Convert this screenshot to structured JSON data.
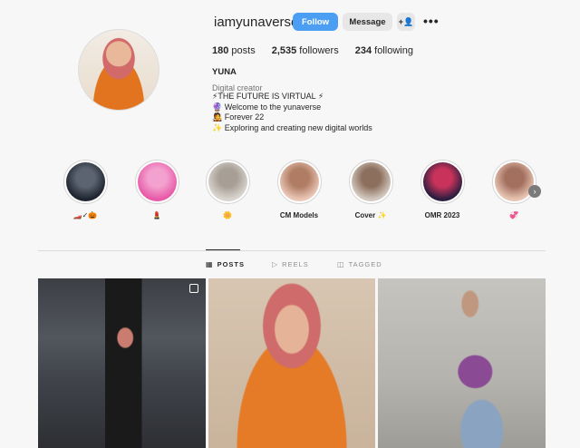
{
  "profile": {
    "username": "iamyunaverse",
    "follow_label": "Follow",
    "message_label": "Message",
    "suggest_icon": "+👤",
    "more_icon": "•••",
    "posts_count": "180",
    "posts_label": " posts",
    "followers_count": "2,535",
    "followers_label": " followers",
    "following_count": "234",
    "following_label": " following",
    "name": "YUNA",
    "category": "Digital creator",
    "bio_lines": [
      "⚡THE FUTURE IS VIRTUAL ⚡",
      "🔮 Welcome to the yunaverse",
      "🧑‍🎤 Forever 22",
      "✨ Exploring and creating new digital worlds"
    ]
  },
  "highlights": [
    {
      "label": "🏎️✓🎃",
      "colors": [
        "#1e2530",
        "#5b6470"
      ]
    },
    {
      "label": "💄",
      "colors": [
        "#e85aa8",
        "#f3a1cf"
      ]
    },
    {
      "label": "🌼",
      "colors": [
        "#d9d4ce",
        "#a79f96"
      ]
    },
    {
      "label": "CM Models",
      "colors": [
        "#e9c6b6",
        "#b07c63"
      ]
    },
    {
      "label": "Cover ✨",
      "colors": [
        "#d2c8bf",
        "#8c6f5d"
      ]
    },
    {
      "label": "OMR 2023",
      "colors": [
        "#2b1e3f",
        "#c9335b"
      ]
    },
    {
      "label": "💞",
      "colors": [
        "#e7c4b2",
        "#a36f5e"
      ]
    }
  ],
  "tabs": [
    {
      "icon": "▦",
      "label": "POSTS"
    },
    {
      "icon": "▷",
      "label": "REELS"
    },
    {
      "icon": "◫",
      "label": "TAGGED"
    }
  ],
  "next_icon": "›"
}
